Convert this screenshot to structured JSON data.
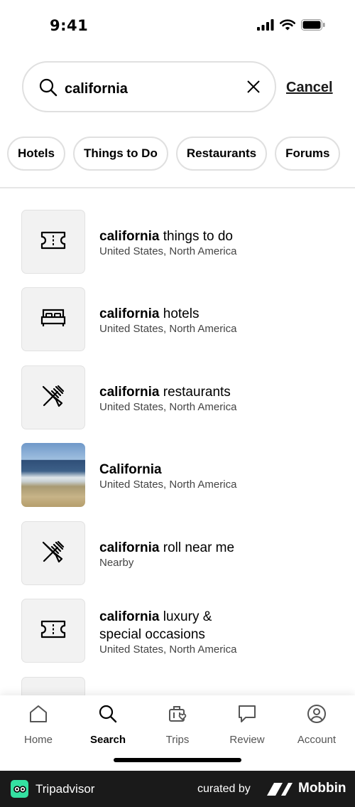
{
  "status_bar": {
    "time": "9:41",
    "icons": [
      "signal-icon",
      "wifi-icon",
      "battery-icon"
    ]
  },
  "search": {
    "value": "california",
    "placeholder": "",
    "cancel_label": "Cancel"
  },
  "chips": [
    "Hotels",
    "Things to Do",
    "Restaurants",
    "Forums"
  ],
  "results": [
    {
      "bold": "california",
      "rest": " things to do",
      "line2_bold": "",
      "line2": "",
      "subtitle": "United States, North America",
      "icon": "ticket-icon"
    },
    {
      "bold": "california",
      "rest": " hotels",
      "line2_bold": "",
      "line2": "",
      "subtitle": "United States, North America",
      "icon": "bed-icon"
    },
    {
      "bold": "california",
      "rest": " restaurants",
      "line2_bold": "",
      "line2": "",
      "subtitle": "United States, North America",
      "icon": "fork-knife-icon"
    },
    {
      "bold": "California",
      "rest": "",
      "line2_bold": "",
      "line2": "",
      "subtitle": "United States, North America",
      "icon": "beach-photo"
    },
    {
      "bold": "california",
      "rest": " roll near me",
      "line2_bold": "",
      "line2": "",
      "subtitle": "Nearby",
      "icon": "fork-knife-icon"
    },
    {
      "bold": "california",
      "rest": " luxury &",
      "line2_bold": "",
      "line2": "special occasions",
      "subtitle": "United States, North America",
      "icon": "ticket-icon"
    }
  ],
  "tabbar": {
    "items": [
      {
        "label": "Home",
        "icon": "home-icon",
        "active": false
      },
      {
        "label": "Search",
        "icon": "search-icon",
        "active": true
      },
      {
        "label": "Trips",
        "icon": "suitcase-heart-icon",
        "active": false
      },
      {
        "label": "Review",
        "icon": "speech-bubble-icon",
        "active": false
      },
      {
        "label": "Account",
        "icon": "user-circle-icon",
        "active": false
      }
    ]
  },
  "footer": {
    "brand": "Tripadvisor",
    "curated_by": "curated by",
    "curator": "Mobbin"
  },
  "colors": {
    "tripadvisor_green": "#34e0a1",
    "footer_bg": "#1a1a1a",
    "chip_border": "#e0e0e0",
    "thumb_bg": "#f2f2f2"
  }
}
